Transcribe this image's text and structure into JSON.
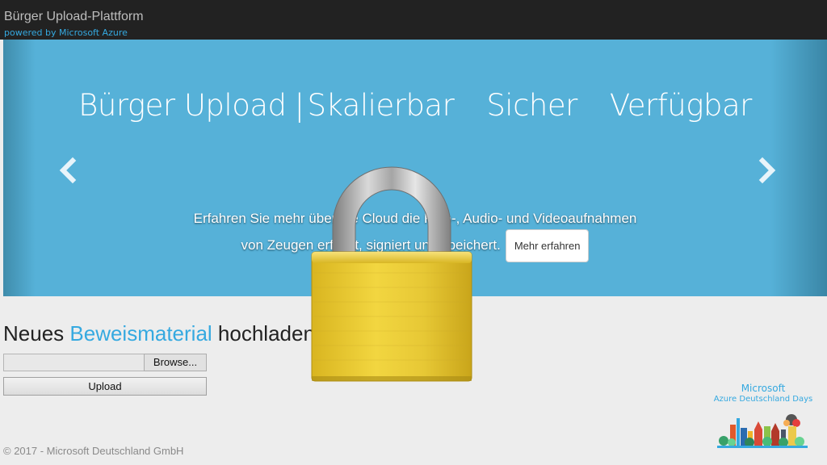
{
  "navbar": {
    "title": "Bürger Upload-Plattform",
    "subtitle": "powered by Microsoft Azure"
  },
  "carousel": {
    "headline": {
      "brand": "Bürger Upload",
      "separator": "|",
      "word1": "Skalierbar",
      "word2": "Sicher",
      "word3": "Verfügbar"
    },
    "caption_line1": "Erfahren Sie mehr über die Cloud die Foto-, Audio- und Videoaufnahmen",
    "caption_line2": "von Zeugen erfasst, signiert und speichert.",
    "more_button": "Mehr erfahren",
    "prev_icon": "chevron-left-icon",
    "next_icon": "chevron-right-icon"
  },
  "upload": {
    "heading_pre": "Neues",
    "heading_accent": "Beweismaterial",
    "heading_post": "hochladen",
    "browse_label": "Browse...",
    "upload_label": "Upload"
  },
  "footer": {
    "copyright": "© 2017 - Microsoft Deutschland GmbH"
  },
  "event_logo": {
    "line1": "Microsoft",
    "line2": "Azure Deutschland Days"
  },
  "overlay": {
    "icon": "padlock-icon"
  },
  "colors": {
    "navbar_bg": "#222222",
    "accent": "#35a9e0",
    "carousel_bg": "#56b1d8",
    "page_bg": "#ededed",
    "padlock_gold": "#e3c233"
  }
}
